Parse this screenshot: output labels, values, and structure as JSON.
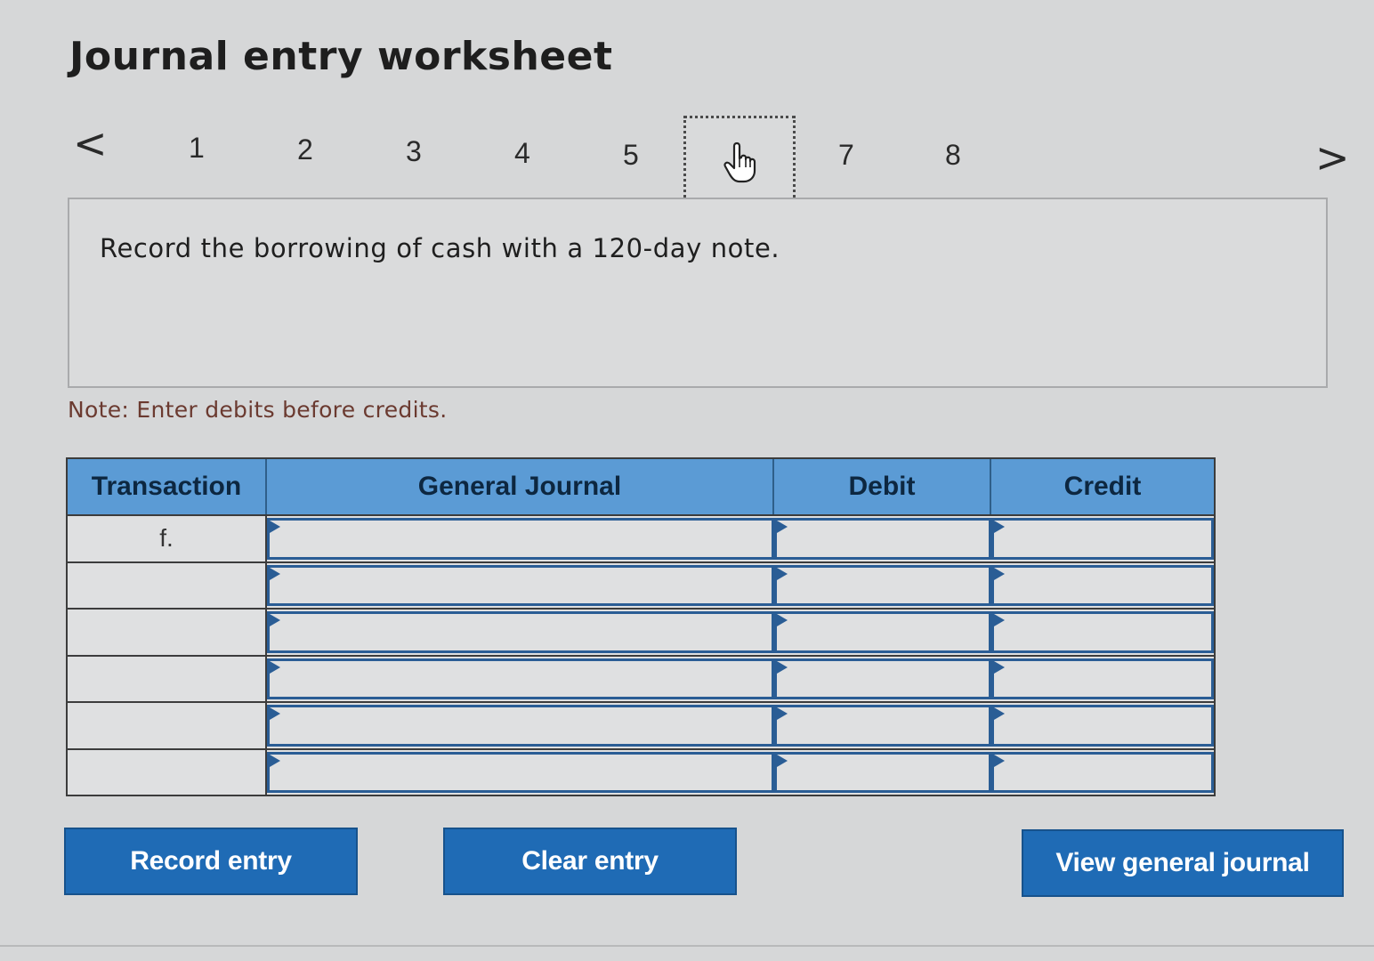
{
  "header": {
    "title": "Journal entry worksheet"
  },
  "pager": {
    "prev_label": "<",
    "next_label": ">",
    "pages": [
      "1",
      "2",
      "3",
      "4",
      "5",
      "6",
      "7",
      "8"
    ],
    "current_page_index": 5,
    "current_cursor_icon": "hand-pointer-icon"
  },
  "prompt": {
    "text": "Record the borrowing of cash with a 120-day note."
  },
  "note": {
    "text": "Note: Enter debits before credits."
  },
  "journal": {
    "columns": [
      "Transaction",
      "General Journal",
      "Debit",
      "Credit"
    ],
    "rows": [
      {
        "transaction": "f.",
        "account": "",
        "debit": "",
        "credit": ""
      },
      {
        "transaction": "",
        "account": "",
        "debit": "",
        "credit": ""
      },
      {
        "transaction": "",
        "account": "",
        "debit": "",
        "credit": ""
      },
      {
        "transaction": "",
        "account": "",
        "debit": "",
        "credit": ""
      },
      {
        "transaction": "",
        "account": "",
        "debit": "",
        "credit": ""
      },
      {
        "transaction": "",
        "account": "",
        "debit": "",
        "credit": ""
      }
    ]
  },
  "buttons": {
    "record": "Record entry",
    "clear": "Clear entry",
    "view": "View general journal"
  },
  "colors": {
    "header_blue": "#5b9bd5",
    "button_blue": "#1f6bb5",
    "note_text": "#6b3a30"
  }
}
